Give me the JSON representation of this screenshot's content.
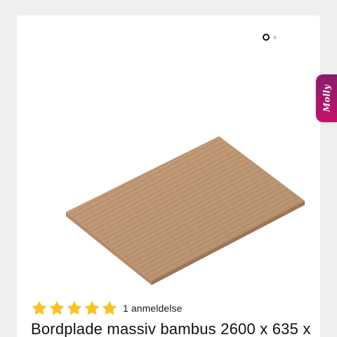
{
  "gallery": {
    "slide_count": 2,
    "active_slide": 1
  },
  "product": {
    "image_alt": "Bamboo countertop",
    "rating": 5,
    "rating_max": 5,
    "review_count_text": "1 anmeldelse",
    "title": "Bordplade massiv bambus 2600 x 635 x"
  },
  "chat_widget": {
    "label": "Molly"
  },
  "colors": {
    "star": "#f7c325",
    "chat_tab_top": "#8a1c6b",
    "chat_tab_bottom": "#c2126a",
    "wood_light": "#c39a76",
    "wood_dark": "#a67c58"
  }
}
